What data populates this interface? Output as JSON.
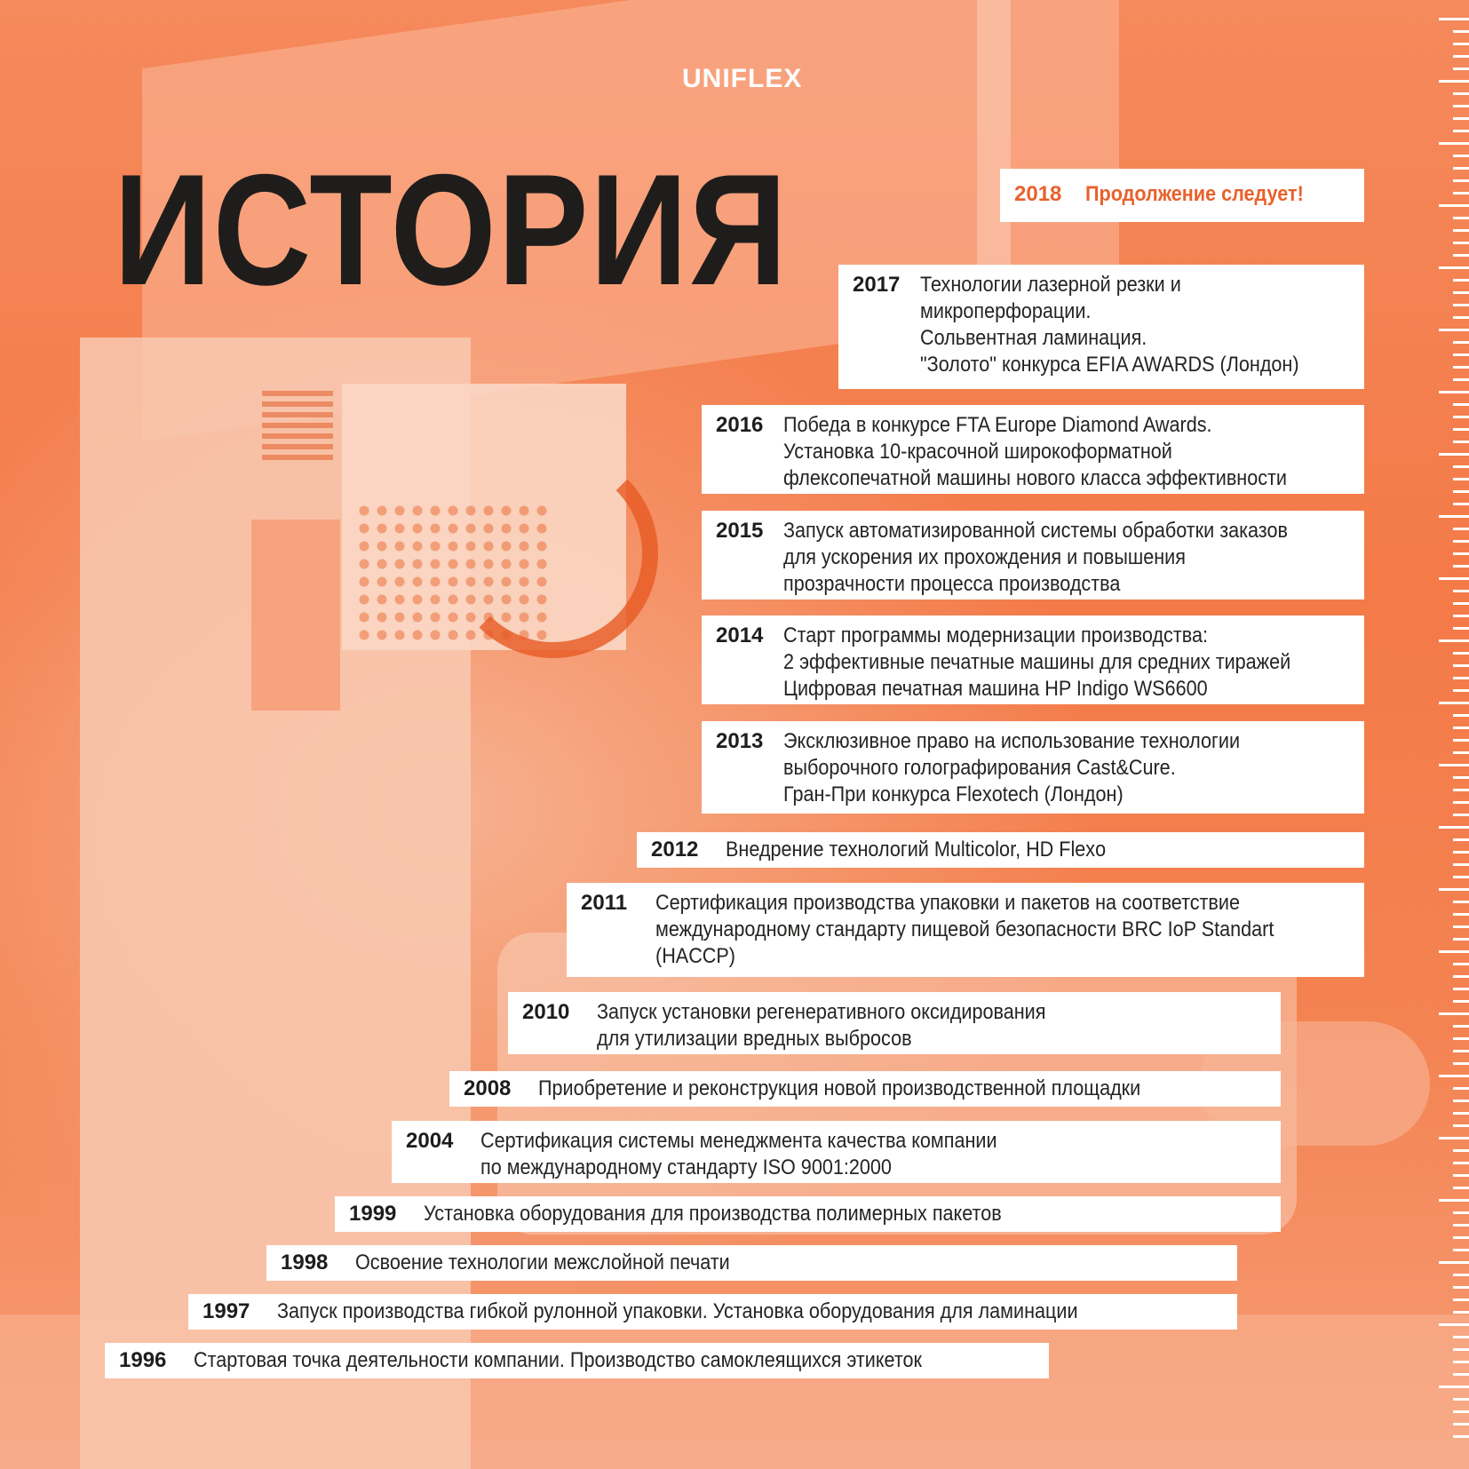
{
  "brand": "UNIFLEX",
  "title": "ИСТОРИЯ",
  "colors": {
    "accent": "#e8612c",
    "dark": "#1f1d1c",
    "bg": "#f47a48"
  },
  "timeline": [
    {
      "year": "2018",
      "text": "Продолжение следует!"
    },
    {
      "year": "2017",
      "text": "Технологии лазерной резки и\nмикроперфорации.\nСольвентная ламинация.\n\"Золото\" конкурса EFIA AWARDS (Лондон)"
    },
    {
      "year": "2016",
      "text": "Победа в конкурсе FTA Europe Diamond Awards.\nУстановка 10-красочной широкоформатной\nфлексопечатной машины нового класса эффективности"
    },
    {
      "year": "2015",
      "text": "Запуск автоматизированной системы обработки заказов\nдля ускорения их прохождения и повышения\nпрозрачности процесса производства"
    },
    {
      "year": "2014",
      "text": "Старт программы модернизации производства:\n2 эффективные печатные машины для средних тиражей\nЦифровая печатная машина HP Indigo WS6600"
    },
    {
      "year": "2013",
      "text": "Эксклюзивное право на использование технологии\nвыборочного голографирования Cast&Cure.\nГран-При конкурса Flexotech (Лондон)"
    },
    {
      "year": "2012",
      "text": "Внедрение технологий Multicolor, HD Flexo"
    },
    {
      "year": "2011",
      "text": "Сертификация производства упаковки и пакетов на соответствие\nмеждународному стандарту пищевой безопасности BRC IoP Standart\n(HACCP)"
    },
    {
      "year": "2010",
      "text": "Запуск установки регенеративного оксидирования\nдля утилизации вредных выбросов"
    },
    {
      "year": "2008",
      "text": "Приобретение и реконструкция новой производственной площадки"
    },
    {
      "year": "2004",
      "text": "Сертификация системы менеджмента качества компании\nпо международному стандарту ISO 9001:2000"
    },
    {
      "year": "1999",
      "text": "Установка оборудования для производства полимерных пакетов"
    },
    {
      "year": "1998",
      "text": "Освоение технологии межслойной печати"
    },
    {
      "year": "1997",
      "text": "Запуск производства гибкой рулонной упаковки. Установка оборудования для ламинации"
    },
    {
      "year": "1996",
      "text": "Стартовая точка деятельности компании. Производство самоклеящихся этикеток"
    }
  ]
}
